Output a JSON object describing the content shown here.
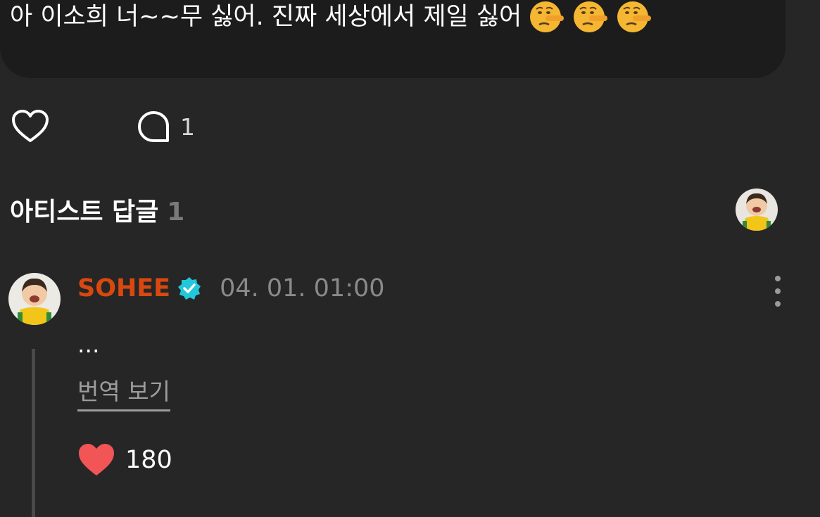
{
  "post": {
    "text": "아 이소희 너~~무 싫어. 진짜 세상에서 제일 싫어",
    "emoji_name": "lying-face-emoji",
    "emoji_count": 3
  },
  "actions": {
    "comment_count": "1"
  },
  "artist_replies": {
    "title": "아티스트 답글",
    "count": "1"
  },
  "reply": {
    "author": "SOHEE",
    "time": "04. 01. 01:00",
    "text": "...",
    "translate_label": "번역 보기",
    "like_count": "180"
  },
  "colors": {
    "background": "#262626",
    "post_bubble": "#1c1c1c",
    "author_name": "#d9480f",
    "verified_badge": "#22c7dc",
    "liked_heart": "#f25555",
    "muted_text": "#8a8a8a"
  }
}
